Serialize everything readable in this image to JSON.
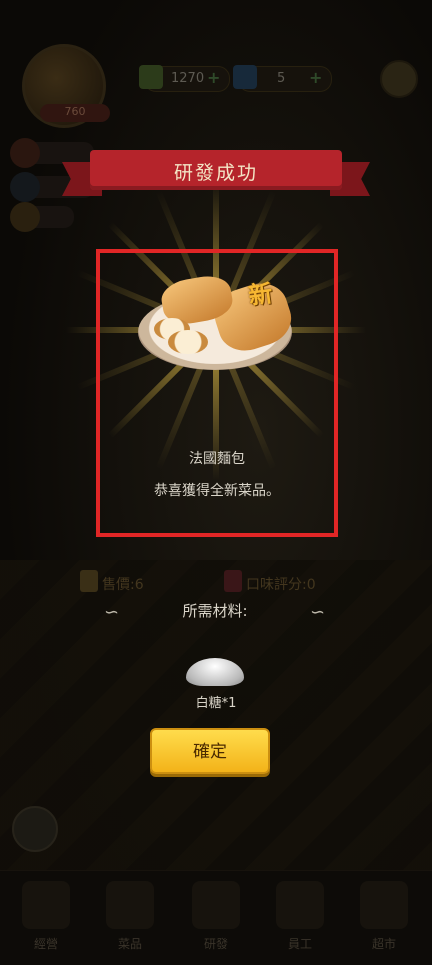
{
  "hud": {
    "coins": "1270",
    "gems": "5",
    "experience": "760"
  },
  "popup": {
    "title": "研發成功",
    "new_badge": "新",
    "dish_name": "法國麵包",
    "message": "恭喜獲得全新菜品。",
    "price_label": "售價:6",
    "rating_label": "口味評分:0",
    "materials_title": "所需材料:",
    "materials": [
      {
        "name": "白糖*1"
      }
    ],
    "confirm_label": "確定"
  },
  "bottom_nav": [
    {
      "label": "經營"
    },
    {
      "label": "菜品"
    },
    {
      "label": "研發"
    },
    {
      "label": "員工"
    },
    {
      "label": "超市"
    }
  ],
  "colors": {
    "ribbon": "#b5242b",
    "highlight_border": "#e12626",
    "confirm_button": "#f3b319",
    "new_badge": "#f6b732"
  }
}
